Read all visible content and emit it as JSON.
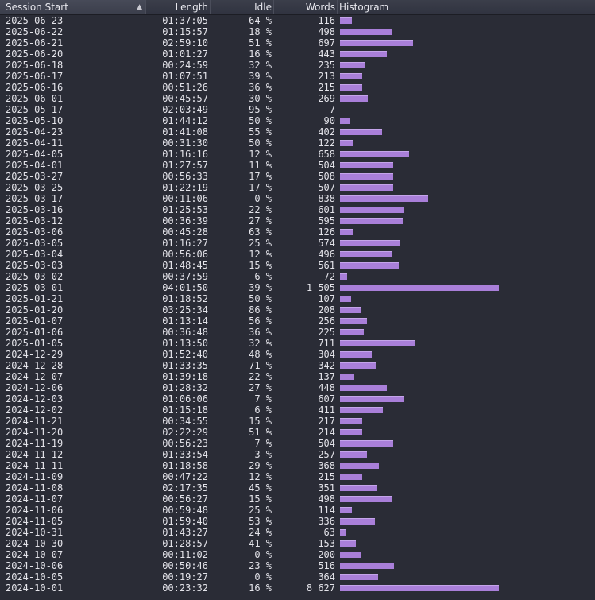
{
  "columns": {
    "session_start": "Session Start",
    "length": "Length",
    "idle": "Idle",
    "words": "Words",
    "histogram": "Histogram"
  },
  "sort_indicator": "▲",
  "colors": {
    "bar": "#a97fd9",
    "background": "#2a2c36"
  },
  "rows": [
    {
      "date": "2025-06-23",
      "length": "01:37:05",
      "idle": "64 %",
      "words": "116",
      "bar": 0.075
    },
    {
      "date": "2025-06-22",
      "length": "01:15:57",
      "idle": "18 %",
      "words": "498",
      "bar": 0.33
    },
    {
      "date": "2025-06-21",
      "length": "02:59:10",
      "idle": "51 %",
      "words": "697",
      "bar": 0.46
    },
    {
      "date": "2025-06-20",
      "length": "01:01:27",
      "idle": "16 %",
      "words": "443",
      "bar": 0.295
    },
    {
      "date": "2025-06-18",
      "length": "00:24:59",
      "idle": "32 %",
      "words": "235",
      "bar": 0.155
    },
    {
      "date": "2025-06-17",
      "length": "01:07:51",
      "idle": "39 %",
      "words": "213",
      "bar": 0.14
    },
    {
      "date": "2025-06-16",
      "length": "00:51:26",
      "idle": "36 %",
      "words": "215",
      "bar": 0.14
    },
    {
      "date": "2025-06-01",
      "length": "00:45:57",
      "idle": "30 %",
      "words": "269",
      "bar": 0.175
    },
    {
      "date": "2025-05-17",
      "length": "02:03:49",
      "idle": "95 %",
      "words": "7",
      "bar": 0
    },
    {
      "date": "2025-05-10",
      "length": "01:44:12",
      "idle": "50 %",
      "words": "90",
      "bar": 0.06
    },
    {
      "date": "2025-04-23",
      "length": "01:41:08",
      "idle": "55 %",
      "words": "402",
      "bar": 0.265
    },
    {
      "date": "2025-04-11",
      "length": "00:31:30",
      "idle": "50 %",
      "words": "122",
      "bar": 0.08
    },
    {
      "date": "2025-04-05",
      "length": "01:16:16",
      "idle": "12 %",
      "words": "658",
      "bar": 0.435
    },
    {
      "date": "2025-04-01",
      "length": "01:27:57",
      "idle": "11 %",
      "words": "504",
      "bar": 0.335
    },
    {
      "date": "2025-03-27",
      "length": "00:56:33",
      "idle": "17 %",
      "words": "508",
      "bar": 0.335
    },
    {
      "date": "2025-03-25",
      "length": "01:22:19",
      "idle": "17 %",
      "words": "507",
      "bar": 0.335
    },
    {
      "date": "2025-03-17",
      "length": "00:11:06",
      "idle": "0 %",
      "words": "838",
      "bar": 0.555
    },
    {
      "date": "2025-03-16",
      "length": "01:25:53",
      "idle": "22 %",
      "words": "601",
      "bar": 0.4
    },
    {
      "date": "2025-03-12",
      "length": "00:36:39",
      "idle": "27 %",
      "words": "595",
      "bar": 0.395
    },
    {
      "date": "2025-03-06",
      "length": "00:45:28",
      "idle": "63 %",
      "words": "126",
      "bar": 0.08
    },
    {
      "date": "2025-03-05",
      "length": "01:16:27",
      "idle": "25 %",
      "words": "574",
      "bar": 0.38
    },
    {
      "date": "2025-03-04",
      "length": "00:56:06",
      "idle": "12 %",
      "words": "496",
      "bar": 0.33
    },
    {
      "date": "2025-03-03",
      "length": "01:48:45",
      "idle": "15 %",
      "words": "561",
      "bar": 0.37
    },
    {
      "date": "2025-03-02",
      "length": "00:37:59",
      "idle": "6 %",
      "words": "72",
      "bar": 0.045
    },
    {
      "date": "2025-03-01",
      "length": "04:01:50",
      "idle": "39 %",
      "words": "1 505",
      "bar": 1.0
    },
    {
      "date": "2025-01-21",
      "length": "01:18:52",
      "idle": "50 %",
      "words": "107",
      "bar": 0.07
    },
    {
      "date": "2025-01-20",
      "length": "03:25:34",
      "idle": "86 %",
      "words": "208",
      "bar": 0.135
    },
    {
      "date": "2025-01-07",
      "length": "01:13:14",
      "idle": "56 %",
      "words": "256",
      "bar": 0.17
    },
    {
      "date": "2025-01-06",
      "length": "00:36:48",
      "idle": "36 %",
      "words": "225",
      "bar": 0.15
    },
    {
      "date": "2025-01-05",
      "length": "01:13:50",
      "idle": "32 %",
      "words": "711",
      "bar": 0.47
    },
    {
      "date": "2024-12-29",
      "length": "01:52:40",
      "idle": "48 %",
      "words": "304",
      "bar": 0.2
    },
    {
      "date": "2024-12-28",
      "length": "01:33:35",
      "idle": "71 %",
      "words": "342",
      "bar": 0.225
    },
    {
      "date": "2024-12-07",
      "length": "01:39:18",
      "idle": "22 %",
      "words": "137",
      "bar": 0.09
    },
    {
      "date": "2024-12-06",
      "length": "01:28:32",
      "idle": "27 %",
      "words": "448",
      "bar": 0.295
    },
    {
      "date": "2024-12-03",
      "length": "01:06:06",
      "idle": "7 %",
      "words": "607",
      "bar": 0.4
    },
    {
      "date": "2024-12-02",
      "length": "01:15:18",
      "idle": "6 %",
      "words": "411",
      "bar": 0.27
    },
    {
      "date": "2024-11-21",
      "length": "00:34:55",
      "idle": "15 %",
      "words": "217",
      "bar": 0.14
    },
    {
      "date": "2024-11-20",
      "length": "02:22:29",
      "idle": "51 %",
      "words": "214",
      "bar": 0.14
    },
    {
      "date": "2024-11-19",
      "length": "00:56:23",
      "idle": "7 %",
      "words": "504",
      "bar": 0.335
    },
    {
      "date": "2024-11-12",
      "length": "01:33:54",
      "idle": "3 %",
      "words": "257",
      "bar": 0.17
    },
    {
      "date": "2024-11-11",
      "length": "01:18:58",
      "idle": "29 %",
      "words": "368",
      "bar": 0.245
    },
    {
      "date": "2024-11-09",
      "length": "00:47:22",
      "idle": "12 %",
      "words": "215",
      "bar": 0.14
    },
    {
      "date": "2024-11-08",
      "length": "02:17:35",
      "idle": "45 %",
      "words": "351",
      "bar": 0.23
    },
    {
      "date": "2024-11-07",
      "length": "00:56:27",
      "idle": "15 %",
      "words": "498",
      "bar": 0.33
    },
    {
      "date": "2024-11-06",
      "length": "00:59:48",
      "idle": "25 %",
      "words": "114",
      "bar": 0.075
    },
    {
      "date": "2024-11-05",
      "length": "01:59:40",
      "idle": "53 %",
      "words": "336",
      "bar": 0.22
    },
    {
      "date": "2024-10-31",
      "length": "01:43:27",
      "idle": "24 %",
      "words": "63",
      "bar": 0.04
    },
    {
      "date": "2024-10-30",
      "length": "01:28:57",
      "idle": "41 %",
      "words": "153",
      "bar": 0.1
    },
    {
      "date": "2024-10-07",
      "length": "00:11:02",
      "idle": "0 %",
      "words": "200",
      "bar": 0.13
    },
    {
      "date": "2024-10-06",
      "length": "00:50:46",
      "idle": "23 %",
      "words": "516",
      "bar": 0.34
    },
    {
      "date": "2024-10-05",
      "length": "00:19:27",
      "idle": "0 %",
      "words": "364",
      "bar": 0.24
    },
    {
      "date": "2024-10-01",
      "length": "00:23:32",
      "idle": "16 %",
      "words": "8 627",
      "bar": 1.0
    }
  ]
}
